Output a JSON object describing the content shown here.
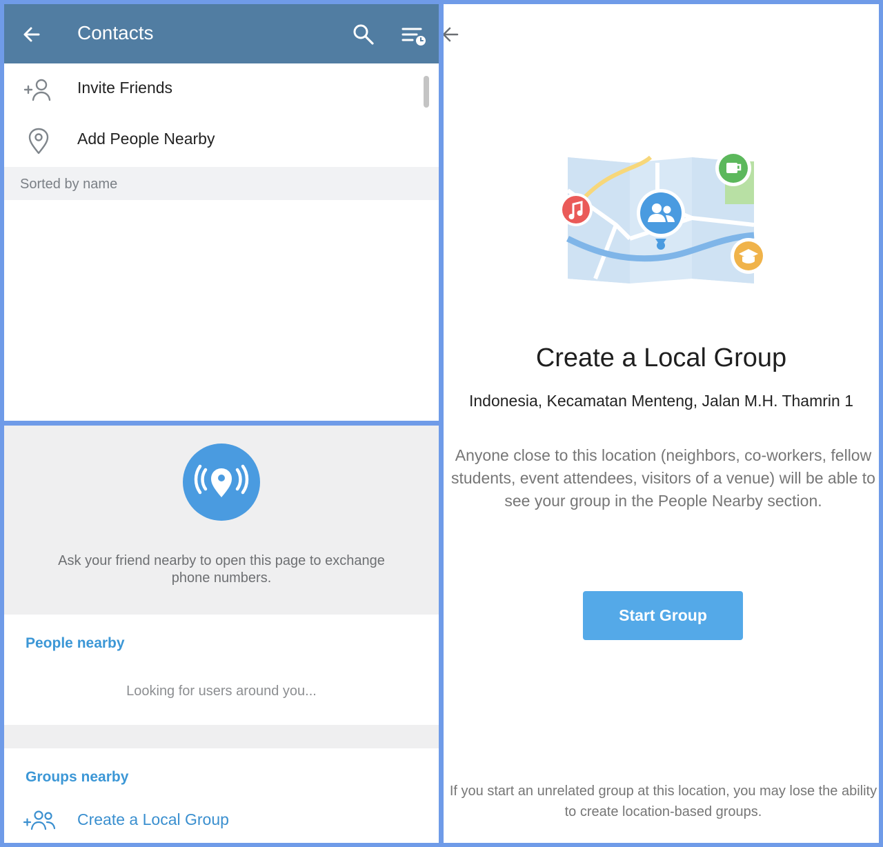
{
  "contacts": {
    "title": "Contacts",
    "header_color": "#517da2",
    "menu": [
      {
        "label": "Invite Friends",
        "icon": "add-person-icon"
      },
      {
        "label": "Add People Nearby",
        "icon": "location-pin-icon"
      }
    ],
    "section_header": "Sorted by name"
  },
  "people_nearby": {
    "hint": "Ask your friend nearby to open this page to exchange phone numbers.",
    "people_header": "People nearby",
    "looking_text": "Looking for users around you...",
    "groups_header": "Groups nearby",
    "create_label": "Create a Local Group",
    "accent_color": "#3c97d6"
  },
  "local_group": {
    "title": "Create a Local Group",
    "address": "Indonesia, Kecamatan Menteng, Jalan M.H. Thamrin 1",
    "description": "Anyone close to this location (neighbors, co-workers, fellow students, event attendees, visitors of a venue) will be able to see your group in the People Nearby section.",
    "button_label": "Start Group",
    "button_color": "#54a9e8",
    "warning": "If you start an unrelated group at this location, you may lose the ability to create location-based groups."
  }
}
